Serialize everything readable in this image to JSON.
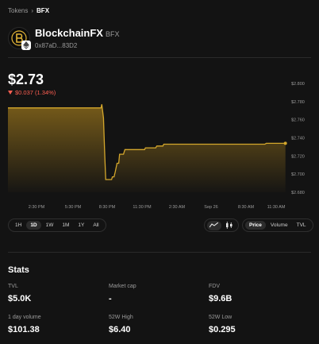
{
  "breadcrumb": {
    "parent": "Tokens",
    "separator": "›",
    "current": "BFX"
  },
  "token": {
    "name": "BlockchainFX",
    "symbol": "BFX",
    "address": "0x87aD...83D2",
    "logo_icon": "bfx-logo-icon",
    "chain_icon": "ethereum-icon"
  },
  "price": {
    "value": "$2.73",
    "change": "$0.037 (1.34%)",
    "change_direction": "down",
    "change_color": "#ff5f52"
  },
  "chart_data": {
    "type": "line",
    "color": "#d4a72c",
    "x_ticks": [
      "2:30 PM",
      "5:30 PM",
      "8:30 PM",
      "11:30 PM",
      "2:30 AM",
      "Sep 26",
      "8:30 AM",
      "11:30 AM"
    ],
    "y_ticks": [
      "$2.800",
      "$2.780",
      "$2.760",
      "$2.740",
      "$2.720",
      "$2.700",
      "$2.680"
    ],
    "ylim": [
      2.68,
      2.8
    ],
    "xlim": [
      0,
      100
    ],
    "x": [
      0,
      33.5,
      33.8,
      34.4,
      34.8,
      35.2,
      37.3,
      37.6,
      38.2,
      38.6,
      39.3,
      39.9,
      40.2,
      41.6,
      42.1,
      42.8,
      45.2,
      49.2,
      49.5,
      53.2,
      53.6,
      55.8,
      56.1,
      66.5,
      66.8,
      92.5,
      93,
      99.9
    ],
    "values": [
      2.773,
      2.773,
      2.777,
      2.762,
      2.726,
      2.694,
      2.694,
      2.697,
      2.697,
      2.702,
      2.712,
      2.712,
      2.722,
      2.722,
      2.727,
      2.727,
      2.727,
      2.727,
      2.729,
      2.729,
      2.731,
      2.731,
      2.733,
      2.733,
      2.733,
      2.733,
      2.734,
      2.734
    ],
    "grid": false
  },
  "range_buttons": [
    "1H",
    "1D",
    "1W",
    "1M",
    "1Y",
    "All"
  ],
  "range_active": "1D",
  "chart_type_buttons": [
    "line-chart-icon",
    "candlestick-icon"
  ],
  "metric_buttons": [
    "Price",
    "Volume",
    "TVL"
  ],
  "metric_active": "Price",
  "stats": {
    "title": "Stats",
    "items": [
      {
        "label": "TVL",
        "value": "$5.0K"
      },
      {
        "label": "Market cap",
        "value": "-"
      },
      {
        "label": "FDV",
        "value": "$9.6B"
      },
      {
        "label": "1 day volume",
        "value": "$101.38"
      },
      {
        "label": "52W High",
        "value": "$6.40"
      },
      {
        "label": "52W Low",
        "value": "$0.295"
      }
    ]
  }
}
